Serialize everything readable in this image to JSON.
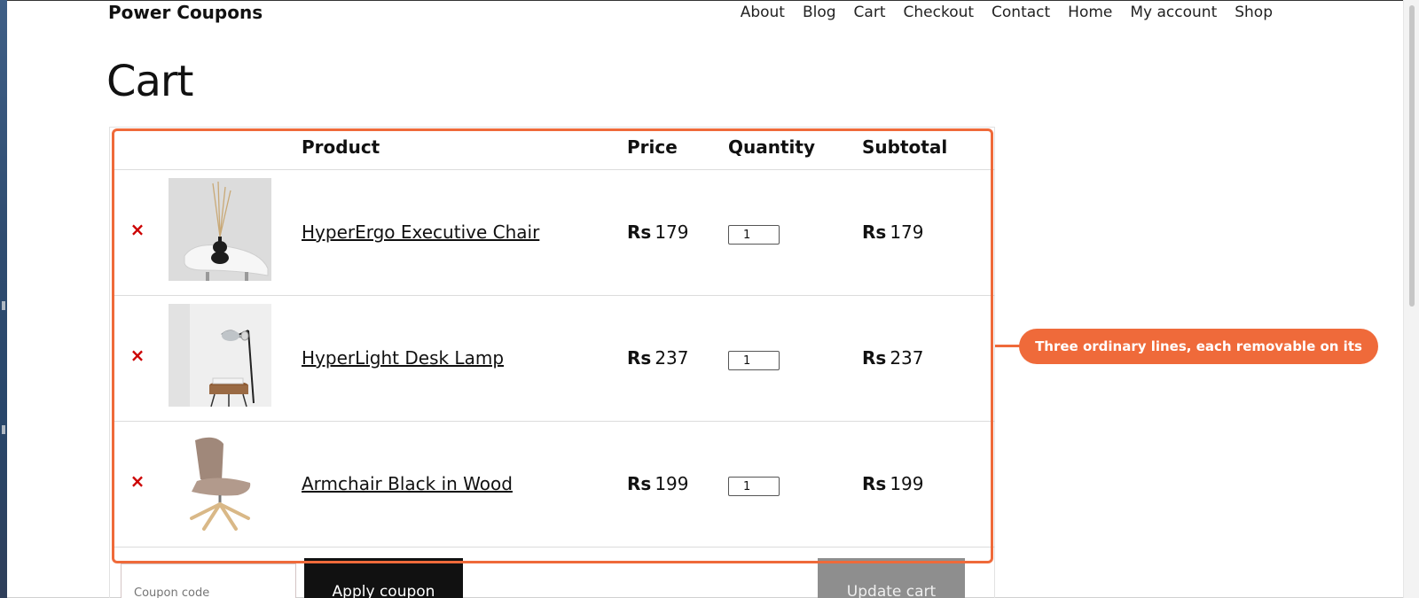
{
  "site": {
    "title": "Power Coupons"
  },
  "nav": [
    "About",
    "Blog",
    "Cart",
    "Checkout",
    "Contact",
    "Home",
    "My account",
    "Shop"
  ],
  "page": {
    "title": "Cart"
  },
  "table": {
    "headers": {
      "product": "Product",
      "price": "Price",
      "quantity": "Quantity",
      "subtotal": "Subtotal"
    },
    "currency": "Rs",
    "items": [
      {
        "name": "HyperErgo Executive Chair",
        "price": "179",
        "quantity": "1",
        "subtotal": "179",
        "image_icon": "chair-vase-photo"
      },
      {
        "name": "HyperLight Desk Lamp",
        "price": "237",
        "quantity": "1",
        "subtotal": "237",
        "image_icon": "desk-lamp-photo"
      },
      {
        "name": "Armchair Black in Wood",
        "price": "199",
        "quantity": "1",
        "subtotal": "199",
        "image_icon": "armchair-photo"
      }
    ],
    "remove_icon": "×"
  },
  "actions": {
    "coupon_placeholder": "Coupon code",
    "apply_label": "Apply coupon",
    "update_label": "Update cart"
  },
  "annotation": {
    "text": "Three ordinary lines, each removable on its own"
  },
  "colors": {
    "accent": "#ef6a3a",
    "remove": "#cc0000",
    "apply_bg": "#111111",
    "update_bg": "#8e8e8e"
  }
}
